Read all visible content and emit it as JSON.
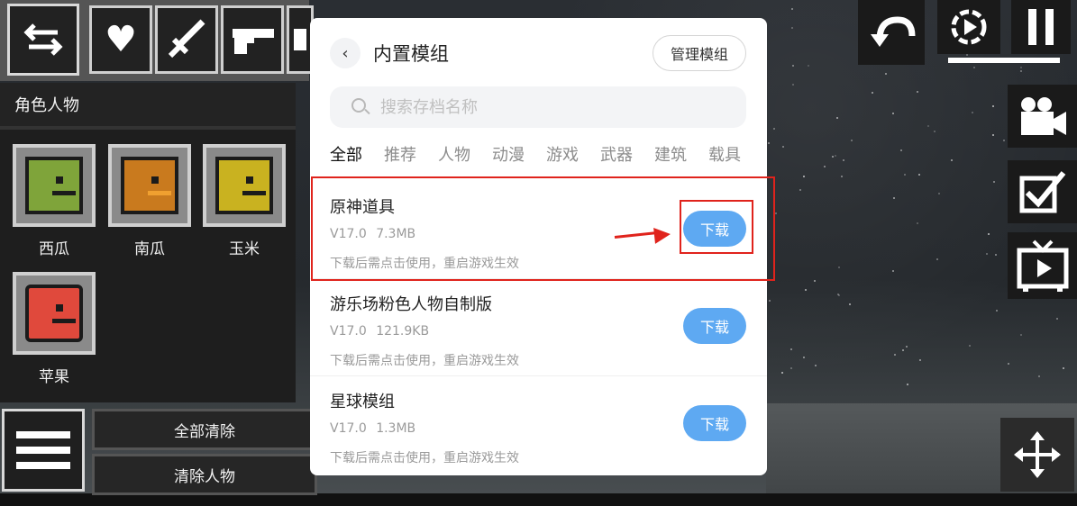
{
  "toolbar": {
    "icons": [
      "swap-icon",
      "heart-icon",
      "sword-icon",
      "pistol-icon",
      "more-icon"
    ]
  },
  "left_panel": {
    "title": "角色人物",
    "items": [
      {
        "label": "西瓜",
        "color": "#7fa43a"
      },
      {
        "label": "南瓜",
        "color": "#c97a1e"
      },
      {
        "label": "玉米",
        "color": "#c9b220"
      },
      {
        "label": "苹果",
        "color": "#e0493c"
      }
    ],
    "clear_all_label": "全部清除",
    "clear_characters_label": "清除人物"
  },
  "dialog": {
    "back_symbol": "‹",
    "title": "内置模组",
    "manage_label": "管理模组",
    "search": {
      "placeholder": "搜索存档名称",
      "value": ""
    },
    "tabs": [
      "全部",
      "推荐",
      "人物",
      "动漫",
      "游戏",
      "武器",
      "建筑",
      "载具"
    ],
    "active_tab": 0,
    "items": [
      {
        "title": "原神道具",
        "version": "V17.0",
        "size": "7.3MB",
        "desc": "下载后需点击使用，重启游戏生效",
        "button": "下载"
      },
      {
        "title": "游乐场粉色人物自制版",
        "version": "V17.0",
        "size": "121.9KB",
        "desc": "下载后需点击使用，重启游戏生效",
        "button": "下载"
      },
      {
        "title": "星球模组",
        "version": "V17.0",
        "size": "1.3MB",
        "desc": "下载后需点击使用，重启游戏生效",
        "button": "下载"
      }
    ]
  },
  "hud": {
    "icons": [
      "undo-icon",
      "slow-motion-icon",
      "pause-icon",
      "camera-icon",
      "checkbox-icon",
      "tv-icon",
      "move-icon"
    ]
  },
  "colors": {
    "accent_blue": "#5ea9f2",
    "highlight_red": "#e0231c"
  }
}
